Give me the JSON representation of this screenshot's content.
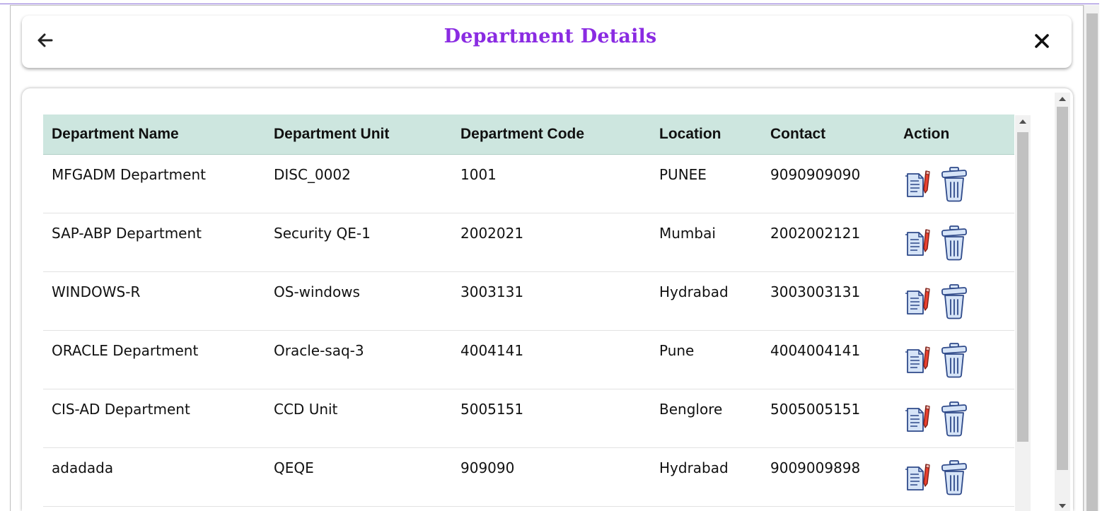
{
  "header": {
    "title": "Department Details",
    "back_icon": "arrow-left-icon",
    "close_icon": "close-icon"
  },
  "table": {
    "columns": [
      "Department Name",
      "Department Unit",
      "Department Code",
      "Location",
      "Contact",
      "Action"
    ],
    "rows": [
      {
        "name": "MFGADM Department",
        "unit": "DISC_0002",
        "code": "1001",
        "location": "PUNEE",
        "contact": "9090909090"
      },
      {
        "name": "SAP-ABP Department",
        "unit": "Security QE-1",
        "code": "2002021",
        "location": "Mumbai",
        "contact": "2002002121"
      },
      {
        "name": "WINDOWS-R",
        "unit": "OS-windows",
        "code": "3003131",
        "location": "Hydrabad",
        "contact": "3003003131"
      },
      {
        "name": "ORACLE Department",
        "unit": "Oracle-saq-3",
        "code": "4004141",
        "location": "Pune",
        "contact": "4004004141"
      },
      {
        "name": "CIS-AD Department",
        "unit": "CCD Unit",
        "code": "5005151",
        "location": "Benglore",
        "contact": "5005005151"
      },
      {
        "name": "adadada",
        "unit": "QEQE",
        "code": "909090",
        "location": "Hydrabad",
        "contact": "9009009898"
      }
    ],
    "actions": {
      "edit_icon": "edit-document-icon",
      "delete_icon": "trash-bin-icon"
    }
  },
  "colors": {
    "title": "#8a2be2",
    "header_row": "#cde6df",
    "icon_fill": "#d6e4f7",
    "icon_stroke": "#2f4a8a",
    "pencil": "#e8402f"
  }
}
